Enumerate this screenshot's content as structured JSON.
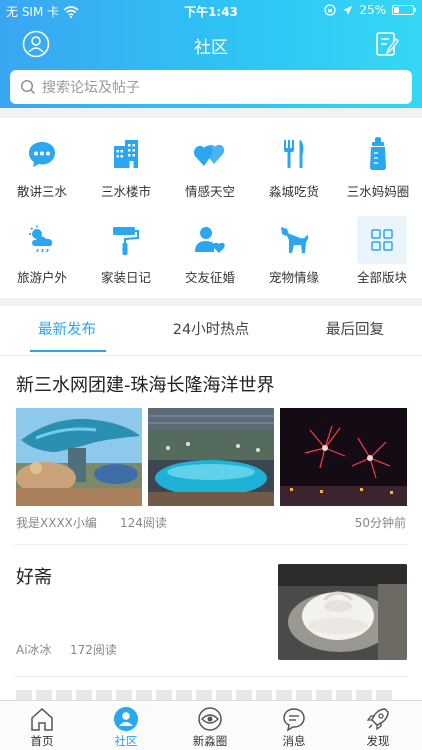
{
  "status_bar": {
    "carrier": "无 SIM 卡",
    "time": "下午1:43",
    "battery": "25%",
    "battery_level": 0.25
  },
  "header": {
    "title": "社区"
  },
  "search": {
    "placeholder": "搜索论坛及帖子"
  },
  "categories": [
    {
      "label": "散讲三水",
      "icon": "chat-bubble-icon"
    },
    {
      "label": "三水楼市",
      "icon": "buildings-icon"
    },
    {
      "label": "情感天空",
      "icon": "hearts-icon"
    },
    {
      "label": "淼城吃货",
      "icon": "fork-knife-icon"
    },
    {
      "label": "三水妈妈圈",
      "icon": "baby-bottle-icon"
    },
    {
      "label": "旅游户外",
      "icon": "weather-icon"
    },
    {
      "label": "家装日记",
      "icon": "paint-roller-icon"
    },
    {
      "label": "交友征婚",
      "icon": "user-heart-icon"
    },
    {
      "label": "宠物情缘",
      "icon": "dog-icon"
    },
    {
      "label": "全部版块",
      "icon": "grid-icon"
    }
  ],
  "tabs": [
    "最新发布",
    "24小时热点",
    "最后回复"
  ],
  "posts": [
    {
      "title": "新三水网团建-珠海长隆海洋世界",
      "author": "我是XXXX小编",
      "reads": "124阅读",
      "time": "50分钟前"
    },
    {
      "title": "好斋",
      "author": "Ai冰冰",
      "reads": "172阅读"
    }
  ],
  "tabbar": [
    "首页",
    "社区",
    "新淼圈",
    "消息",
    "发现"
  ],
  "colors": {
    "accent": "#2aa7ee",
    "header_start": "#3aa6f2",
    "header_end": "#35d7f4"
  }
}
